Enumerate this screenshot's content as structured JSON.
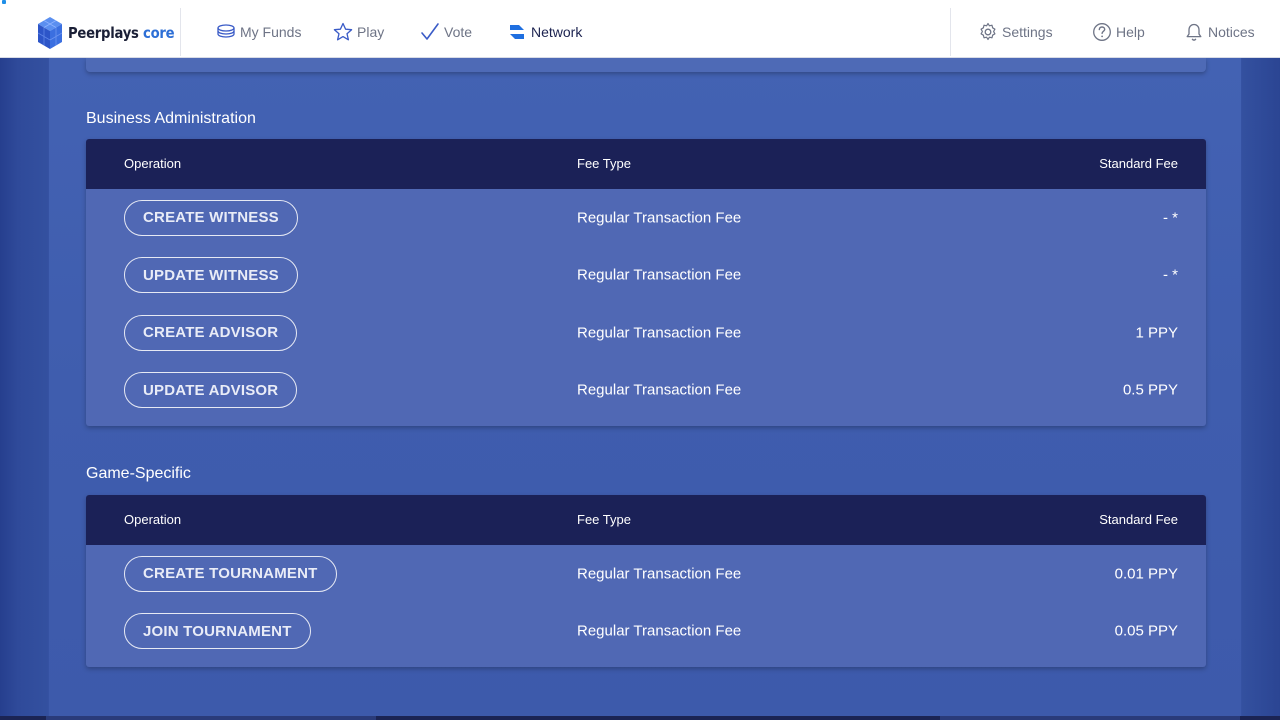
{
  "header": {
    "logo": {
      "name": "Peerplays",
      "accent": "core"
    },
    "nav": [
      {
        "label": "My Funds",
        "icon": "coins-icon"
      },
      {
        "label": "Play",
        "icon": "star-icon"
      },
      {
        "label": "Vote",
        "icon": "checkmark-icon"
      },
      {
        "label": "Network",
        "icon": "network-icon",
        "active": true
      }
    ],
    "right_nav": [
      {
        "label": "Settings",
        "icon": "gear-icon"
      },
      {
        "label": "Help",
        "icon": "help-icon"
      },
      {
        "label": "Notices",
        "icon": "bell-icon"
      }
    ]
  },
  "sections": [
    {
      "title": "Business Administration",
      "columns": {
        "operation": "Operation",
        "fee_type": "Fee Type",
        "standard_fee": "Standard Fee"
      },
      "rows": [
        {
          "operation": "CREATE WITNESS",
          "fee_type": "Regular Transaction Fee",
          "fee": "- *"
        },
        {
          "operation": "UPDATE WITNESS",
          "fee_type": "Regular Transaction Fee",
          "fee": "- *"
        },
        {
          "operation": "CREATE ADVISOR",
          "fee_type": "Regular Transaction Fee",
          "fee": "1 PPY"
        },
        {
          "operation": "UPDATE ADVISOR",
          "fee_type": "Regular Transaction Fee",
          "fee": "0.5 PPY"
        }
      ]
    },
    {
      "title": "Game-Specific",
      "columns": {
        "operation": "Operation",
        "fee_type": "Fee Type",
        "standard_fee": "Standard Fee"
      },
      "rows": [
        {
          "operation": "CREATE TOURNAMENT",
          "fee_type": "Regular Transaction Fee",
          "fee": "0.01 PPY"
        },
        {
          "operation": "JOIN TOURNAMENT",
          "fee_type": "Regular Transaction Fee",
          "fee": "0.05 PPY"
        }
      ]
    }
  ],
  "colors": {
    "header_bg": "#ffffff",
    "table_head_bg": "#1b2157",
    "card_bg": "#5068b4",
    "page_bg": "#3d5cab",
    "brand_blue": "#2d6fd6"
  }
}
